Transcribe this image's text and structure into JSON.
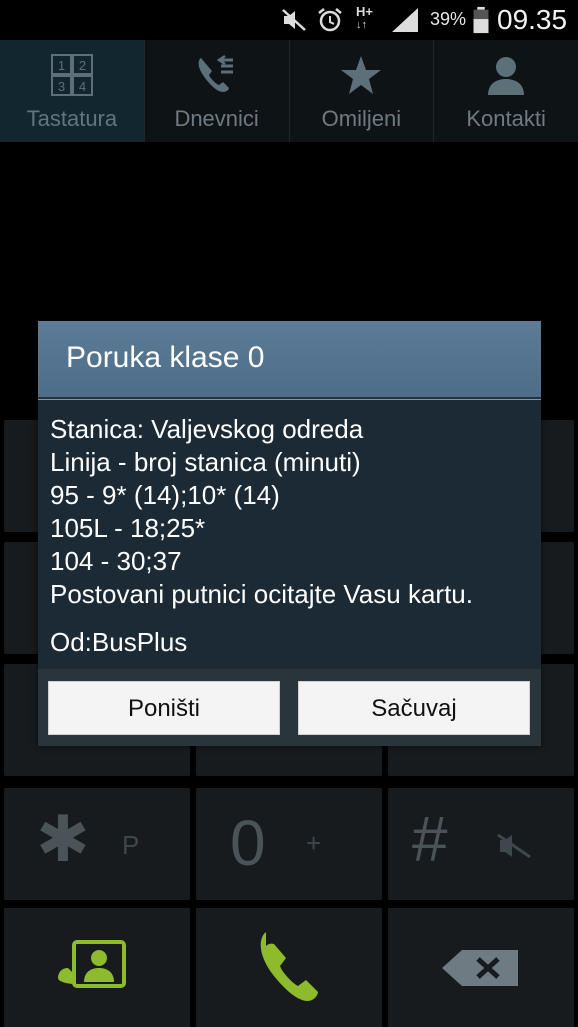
{
  "status_bar": {
    "battery_percent": "39%",
    "time": "09.35",
    "network_type": "H+",
    "icons": [
      "mute-icon",
      "alarm-icon",
      "hplus-data-icon",
      "signal-icon",
      "battery-icon"
    ]
  },
  "tabs": [
    {
      "label": "Tastatura",
      "icon": "keypad-icon",
      "active": true
    },
    {
      "label": "Dnevnici",
      "icon": "call-log-icon",
      "active": false
    },
    {
      "label": "Omiljeni",
      "icon": "star-icon",
      "active": false
    },
    {
      "label": "Kontakti",
      "icon": "contact-icon",
      "active": false
    }
  ],
  "keypad_tab_digits": [
    "1",
    "2",
    "3",
    "4"
  ],
  "dialpad": {
    "star_key": {
      "digit": "✱",
      "sub": "P"
    },
    "zero_key": {
      "digit": "0",
      "sub": "+"
    },
    "hash_key": {
      "digit": "#"
    }
  },
  "dialog": {
    "title": "Poruka klase 0",
    "lines": [
      "Stanica: Valjevskog odreda",
      "Linija - broj stanica (minuti)",
      "95 - 9* (14);10* (14)",
      "105L - 18;25*",
      "104 - 30;37",
      "Postovani putnici ocitajte Vasu kartu."
    ],
    "sender": "Od:BusPlus",
    "cancel_label": "Poništi",
    "save_label": "Sačuvaj"
  },
  "colors": {
    "dialog_header": "#557590",
    "dialog_body": "#1b2a35",
    "call_green": "#8dbb2c"
  }
}
